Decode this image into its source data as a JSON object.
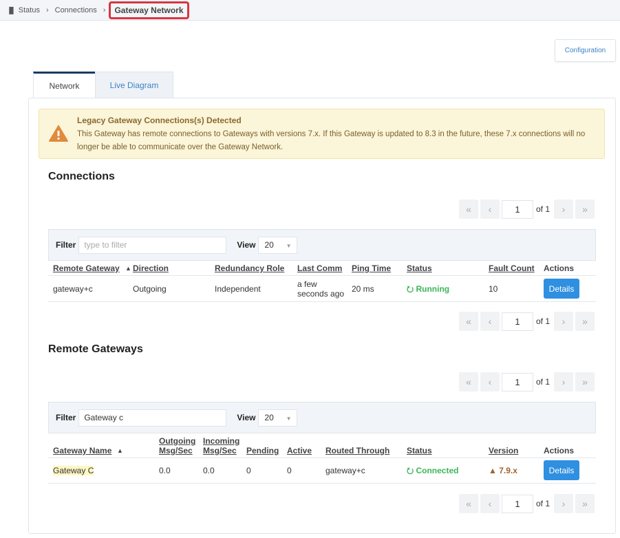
{
  "breadcrumb": {
    "items": [
      "Status",
      "Connections"
    ],
    "current": "Gateway Network"
  },
  "header": {
    "config_label": "Configuration"
  },
  "tabs": [
    {
      "label": "Network",
      "active": true
    },
    {
      "label": "Live Diagram",
      "active": false
    }
  ],
  "alert": {
    "title": "Legacy Gateway Connections(s) Detected",
    "message": "This Gateway has remote connections to Gateways with versions 7.x. If this Gateway is updated to 8.3 in the future, these 7.x connections will no longer be able to communicate over the Gateway Network.",
    "color": "#fbf5d9"
  },
  "connections": {
    "title": "Connections",
    "pager_top": {
      "page": "1",
      "of": "of 1"
    },
    "pager_bottom": {
      "page": "1",
      "of": "of 1"
    },
    "filter_label": "Filter",
    "filter_placeholder": "type to filter",
    "view_label": "View",
    "view_value": "20",
    "columns": [
      "Remote Gateway",
      "Direction",
      "Redundancy Role",
      "Last Comm",
      "Ping Time",
      "Status",
      "Fault Count",
      "Actions"
    ],
    "rows": [
      {
        "remote_gateway": "gateway+c",
        "direction": "Outgoing",
        "redundancy_role": "Independent",
        "last_comm": "a few seconds ago",
        "ping_time": "20 ms",
        "status": "Running",
        "fault_count": "10",
        "action": "Details"
      }
    ]
  },
  "remote_gateways": {
    "title": "Remote Gateways",
    "pager_top": {
      "page": "1",
      "of": "of 1"
    },
    "pager_bottom": {
      "page": "1",
      "of": "of 1"
    },
    "filter_label": "Filter",
    "filter_value": "Gateway c",
    "view_label": "View",
    "view_value": "20",
    "columns": [
      "Gateway Name",
      "Outgoing Msg/Sec",
      "Incoming Msg/Sec",
      "Pending",
      "Active",
      "Routed Through",
      "Status",
      "Version",
      "Actions"
    ],
    "rows": [
      {
        "gateway_name": "Gateway C",
        "outgoing": "0.0",
        "incoming": "0.0",
        "pending": "0",
        "active": "0",
        "routed_through": "gateway+c",
        "status": "Connected",
        "version": "7.9.x",
        "action": "Details"
      }
    ]
  },
  "colors": {
    "accent": "#2f8fe0",
    "status_ok": "#3cb55a",
    "warning": "#a0632a",
    "highlight_border": "#d9363e"
  }
}
